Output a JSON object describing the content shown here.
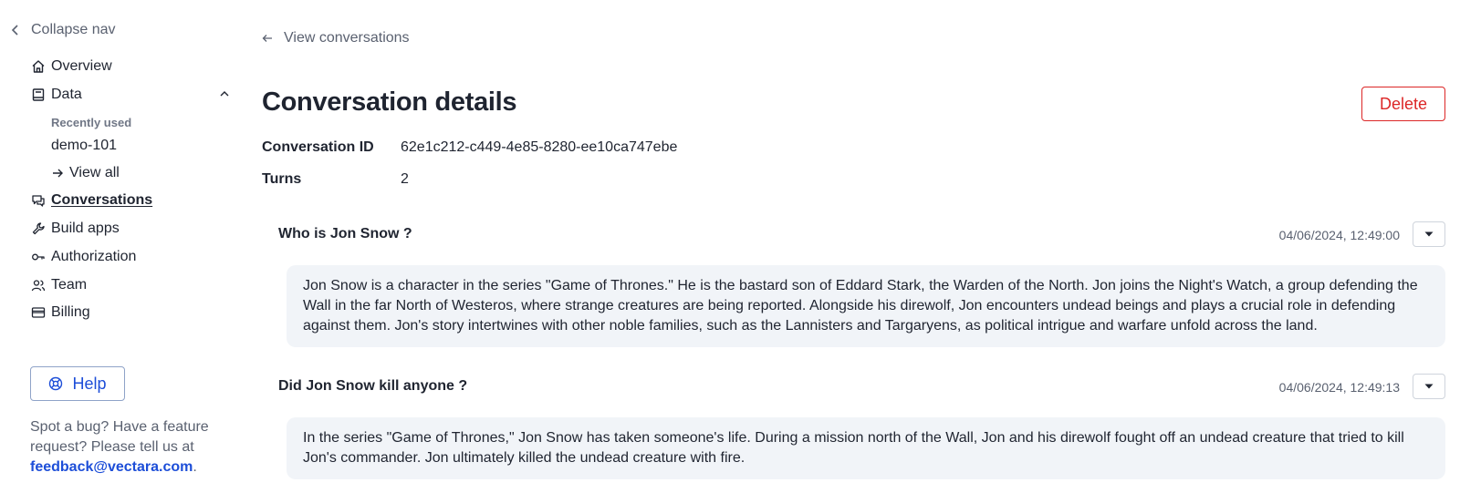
{
  "sidebar": {
    "collapse_label": "Collapse nav",
    "items": {
      "overview": "Overview",
      "data": "Data",
      "recently_used": "Recently used",
      "corpus": "demo-101",
      "view_all": "View all",
      "conversations": "Conversations",
      "build_apps": "Build apps",
      "authorization": "Authorization",
      "team": "Team",
      "billing": "Billing"
    },
    "help_label": "Help",
    "feedback_text": "Spot a bug? Have a feature request? Please tell us at ",
    "feedback_email": "feedback@vectara.com",
    "feedback_end": "."
  },
  "main": {
    "back_label": "View conversations",
    "title": "Conversation details",
    "delete_label": "Delete",
    "meta": {
      "id_label": "Conversation ID",
      "id_value": "62e1c212-c449-4e85-8280-ee10ca747ebe",
      "turns_label": "Turns",
      "turns_value": "2"
    },
    "turns": [
      {
        "question": "Who is Jon Snow ?",
        "timestamp": "04/06/2024, 12:49:00",
        "answer": "Jon Snow is a character in the series \"Game of Thrones.\" He is the bastard son of Eddard Stark, the Warden of the North. Jon joins the Night's Watch, a group defending the Wall in the far North of Westeros, where strange creatures are being reported. Alongside his direwolf, Jon encounters undead beings and plays a crucial role in defending against them. Jon's story intertwines with other noble families, such as the Lannisters and Targaryens, as political intrigue and warfare unfold across the land."
      },
      {
        "question": "Did Jon Snow kill anyone ?",
        "timestamp": "04/06/2024, 12:49:13",
        "answer": "In the series \"Game of Thrones,\" Jon Snow has taken someone's life. During a mission north of the Wall, Jon and his direwolf fought off an undead creature that tried to kill Jon's commander. Jon ultimately killed the undead creature with fire."
      }
    ]
  },
  "colors": {
    "accent": "#1d4ed8",
    "danger": "#dc2626",
    "answer_bg": "#f1f4f8"
  }
}
